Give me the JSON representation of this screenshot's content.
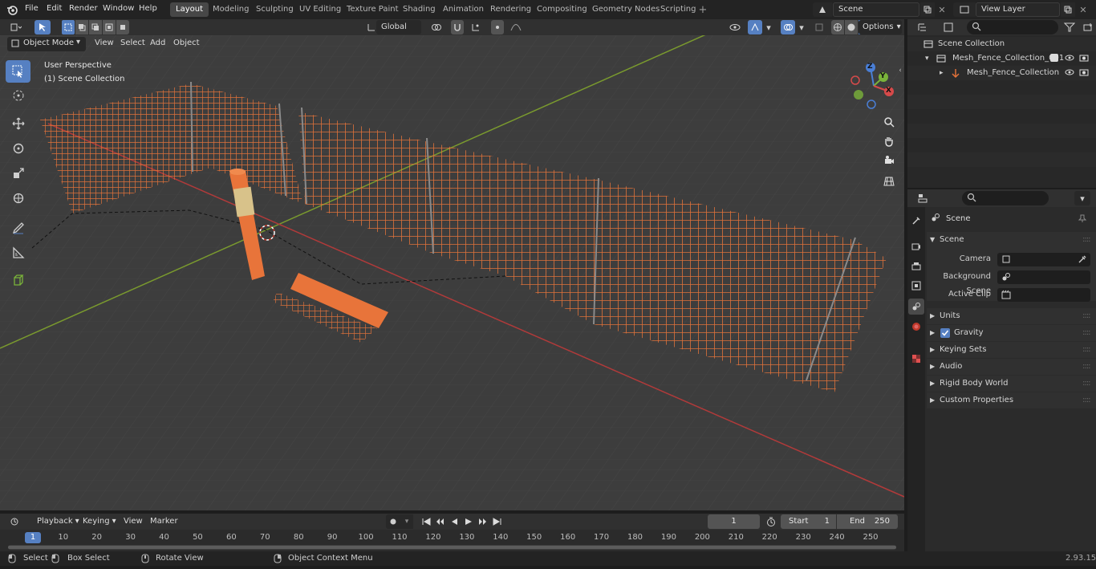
{
  "topbar": {
    "menus": [
      "File",
      "Edit",
      "Render",
      "Window",
      "Help"
    ],
    "workspaces": [
      "Layout",
      "Modeling",
      "Sculpting",
      "UV Editing",
      "Texture Paint",
      "Shading",
      "Animation",
      "Rendering",
      "Compositing",
      "Geometry Nodes",
      "Scripting"
    ],
    "active_workspace": "Layout",
    "scene_name": "Scene",
    "view_layer": "View Layer",
    "add_workspace": "+"
  },
  "viewport_header": {
    "mode": "Object Mode",
    "view": "View",
    "select": "Select",
    "add": "Add",
    "object": "Object",
    "transform_orientation": "Global",
    "options": "Options"
  },
  "viewport": {
    "perspective_label": "User Perspective",
    "collection_label": "(1) Scene Collection",
    "gizmo": {
      "z": "Z",
      "y": "Y",
      "x": "X"
    },
    "colors": {
      "grid_bg": "#3d3d3d",
      "x_axis": "#b13a3a",
      "y_axis": "#7a9a2e",
      "fence": "#e8743a",
      "selected_tool": "#5680c2"
    }
  },
  "outliner": {
    "root": "Scene Collection",
    "items": [
      {
        "label": "Mesh_Fence_Collection_001",
        "level": 1
      },
      {
        "label": "Mesh_Fence_Collection",
        "level": 2
      }
    ]
  },
  "properties": {
    "context": "Scene",
    "section": "Scene",
    "fields": [
      {
        "label": "Camera",
        "value": ""
      },
      {
        "label": "Background Scene",
        "value": ""
      },
      {
        "label": "Active Clip",
        "value": ""
      }
    ],
    "panels": [
      "Units",
      "Gravity",
      "Keying Sets",
      "Audio",
      "Rigid Body World",
      "Custom Properties"
    ],
    "gravity_checked": true
  },
  "timeline": {
    "playback": "Playback",
    "keying": "Keying",
    "view": "View",
    "marker": "Marker",
    "current_frame": "1",
    "start_label": "Start",
    "start": "1",
    "end_label": "End",
    "end": "250",
    "ticks": [
      "1",
      "10",
      "20",
      "30",
      "40",
      "50",
      "60",
      "70",
      "80",
      "90",
      "100",
      "110",
      "120",
      "130",
      "140",
      "150",
      "160",
      "170",
      "180",
      "190",
      "200",
      "210",
      "220",
      "230",
      "240",
      "250"
    ]
  },
  "statusbar": {
    "select": "Select",
    "box_select": "Box Select",
    "rotate_view": "Rotate View",
    "context_menu": "Object Context Menu",
    "version": "2.93.15"
  }
}
